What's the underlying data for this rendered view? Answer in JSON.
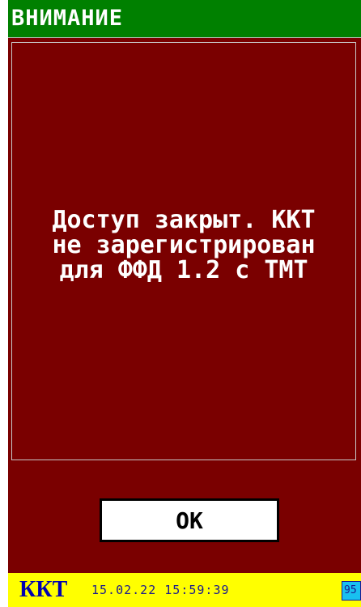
{
  "titlebar": {
    "title": "ВНИМАНИЕ"
  },
  "message": {
    "text": "Доступ закрыт. ККТ\nне зарегистрирован\nдля ФФД 1.2 с ТМТ"
  },
  "dialog": {
    "ok_label": "OK"
  },
  "statusbar": {
    "label": "ККТ",
    "datetime": "15.02.22 15:59:39",
    "badge": "95"
  },
  "colors": {
    "titlebar": "#008000",
    "background": "#7a0000",
    "statusbar": "#ffff00",
    "status_text": "#0000b0",
    "badge": "#18c0f0"
  }
}
